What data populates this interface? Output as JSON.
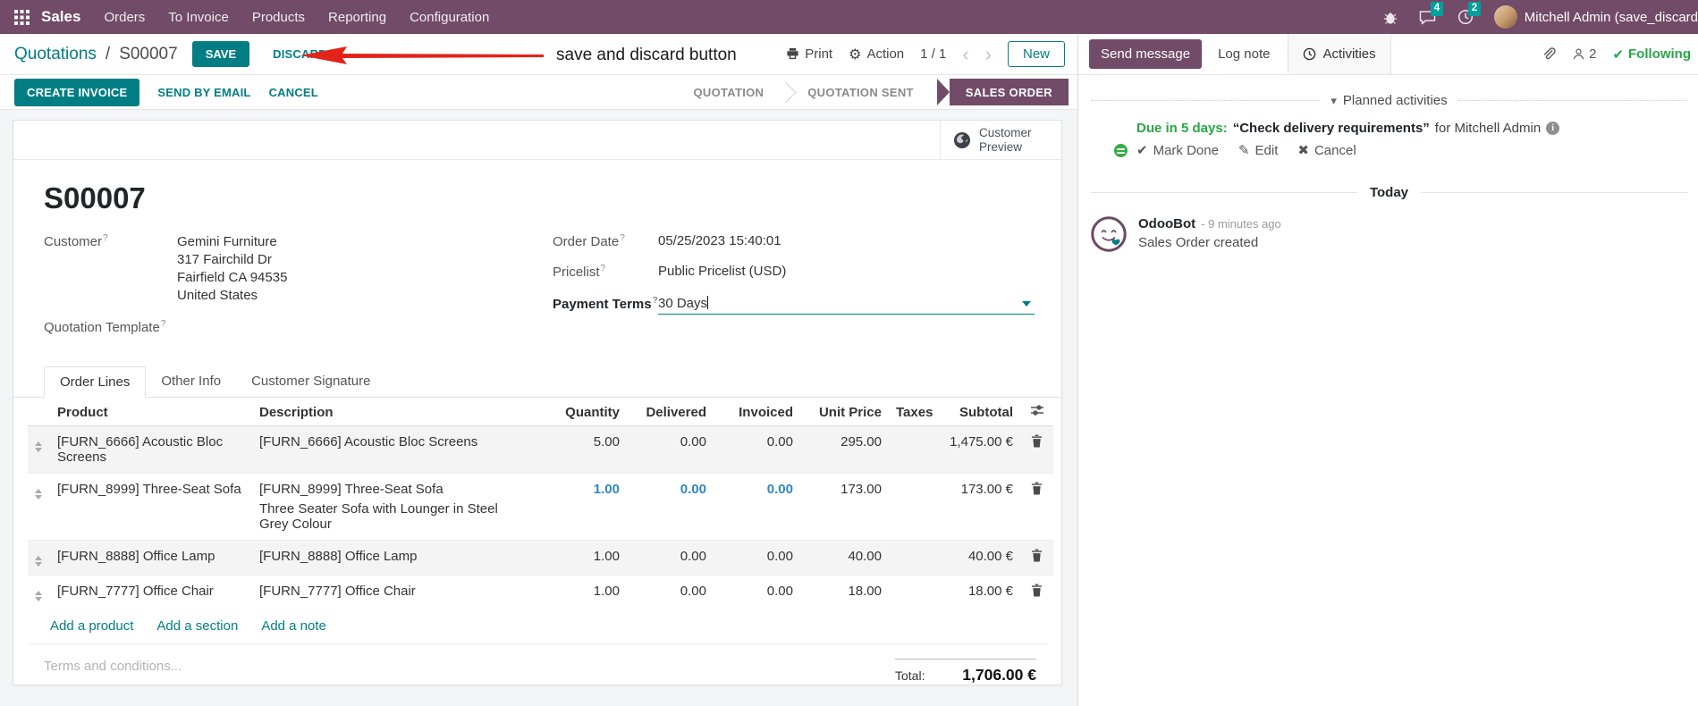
{
  "nav": {
    "app_name": "Sales",
    "menus": [
      "Orders",
      "To Invoice",
      "Products",
      "Reporting",
      "Configuration"
    ],
    "messages_badge": "4",
    "activities_badge": "2",
    "user_name": "Mitchell Admin (save_discard"
  },
  "control_panel": {
    "breadcrumb_parent": "Quotations",
    "breadcrumb_sep": "/",
    "breadcrumb_current": "S00007",
    "save_label": "SAVE",
    "discard_label": "DISCARD",
    "print_label": "Print",
    "action_label": "Action",
    "pager": "1 / 1",
    "new_label": "New"
  },
  "annotation": {
    "text": "save and discard button"
  },
  "actions": {
    "create_invoice": "CREATE INVOICE",
    "send_by_email": "SEND BY EMAIL",
    "cancel": "CANCEL"
  },
  "statusbar": {
    "steps": [
      {
        "label": "QUOTATION",
        "active": false
      },
      {
        "label": "QUOTATION SENT",
        "active": false
      },
      {
        "label": "SALES ORDER",
        "active": true
      }
    ]
  },
  "sheet": {
    "customer_preview_line1": "Customer",
    "customer_preview_line2": "Preview",
    "title": "S00007",
    "help_marker": "?",
    "fields": {
      "customer_label": "Customer",
      "customer_name": "Gemini Furniture",
      "address_line1": "317 Fairchild Dr",
      "address_line2": "Fairfield CA 94535",
      "address_line3": "United States",
      "quotation_template_label": "Quotation Template",
      "order_date_label": "Order Date",
      "order_date": "05/25/2023 15:40:01",
      "pricelist_label": "Pricelist",
      "pricelist": "Public Pricelist (USD)",
      "payment_terms_label": "Payment Terms",
      "payment_terms": "30 Days"
    },
    "tabs": {
      "order_lines": "Order Lines",
      "other_info": "Other Info",
      "customer_signature": "Customer Signature"
    },
    "table": {
      "columns": [
        "Product",
        "Description",
        "Quantity",
        "Delivered",
        "Invoiced",
        "Unit Price",
        "Taxes",
        "Subtotal"
      ],
      "rows": [
        {
          "product": "[FURN_6666] Acoustic Bloc Screens",
          "description": "[FURN_6666] Acoustic Bloc Screens",
          "quantity": "5.00",
          "delivered": "0.00",
          "invoiced": "0.00",
          "unit_price": "295.00",
          "taxes": "",
          "subtotal": "1,475.00 €"
        },
        {
          "product": "[FURN_8999] Three-Seat Sofa",
          "description": "[FURN_8999] Three-Seat Sofa",
          "description2": "Three Seater Sofa with Lounger in Steel Grey Colour",
          "quantity": "1.00",
          "delivered": "0.00",
          "invoiced": "0.00",
          "unit_price": "173.00",
          "taxes": "",
          "subtotal": "173.00 €"
        },
        {
          "product": "[FURN_8888] Office Lamp",
          "description": "[FURN_8888] Office Lamp",
          "quantity": "1.00",
          "delivered": "0.00",
          "invoiced": "0.00",
          "unit_price": "40.00",
          "taxes": "",
          "subtotal": "40.00 €"
        },
        {
          "product": "[FURN_7777] Office Chair",
          "description": "[FURN_7777] Office Chair",
          "quantity": "1.00",
          "delivered": "0.00",
          "invoiced": "0.00",
          "unit_price": "18.00",
          "taxes": "",
          "subtotal": "18.00 €"
        }
      ],
      "add_links": [
        "Add a product",
        "Add a section",
        "Add a note"
      ]
    },
    "terms_placeholder": "Terms and conditions...",
    "total_label": "Total:",
    "total_value": "1,706.00 €"
  },
  "chatter": {
    "send_message": "Send message",
    "log_note": "Log note",
    "activities": "Activities",
    "followers_count": "2",
    "following": "Following",
    "planned_activities_title": "Planned activities",
    "activity": {
      "due": "Due in 5 days:",
      "summary": "“Check delivery requirements”",
      "for_text": "for Mitchell Admin",
      "mark_done": "Mark Done",
      "edit": "Edit",
      "cancel": "Cancel"
    },
    "today": "Today",
    "message": {
      "author": "OdooBot",
      "time": "- 9 minutes ago",
      "body": "Sales Order created"
    }
  },
  "icons": {
    "gear": "⚙",
    "check": "✔",
    "edit": "✎",
    "cancel": "✖",
    "caret_down": "▾",
    "chevron_prev": "‹",
    "chevron_next": "›"
  },
  "colors": {
    "brand_purple": "#714B67",
    "accent_teal": "#017E84",
    "badge_teal": "#00A09D",
    "success_green": "#28a745",
    "modified_blue": "#2E87C3",
    "annotation_red": "#E2231A"
  }
}
